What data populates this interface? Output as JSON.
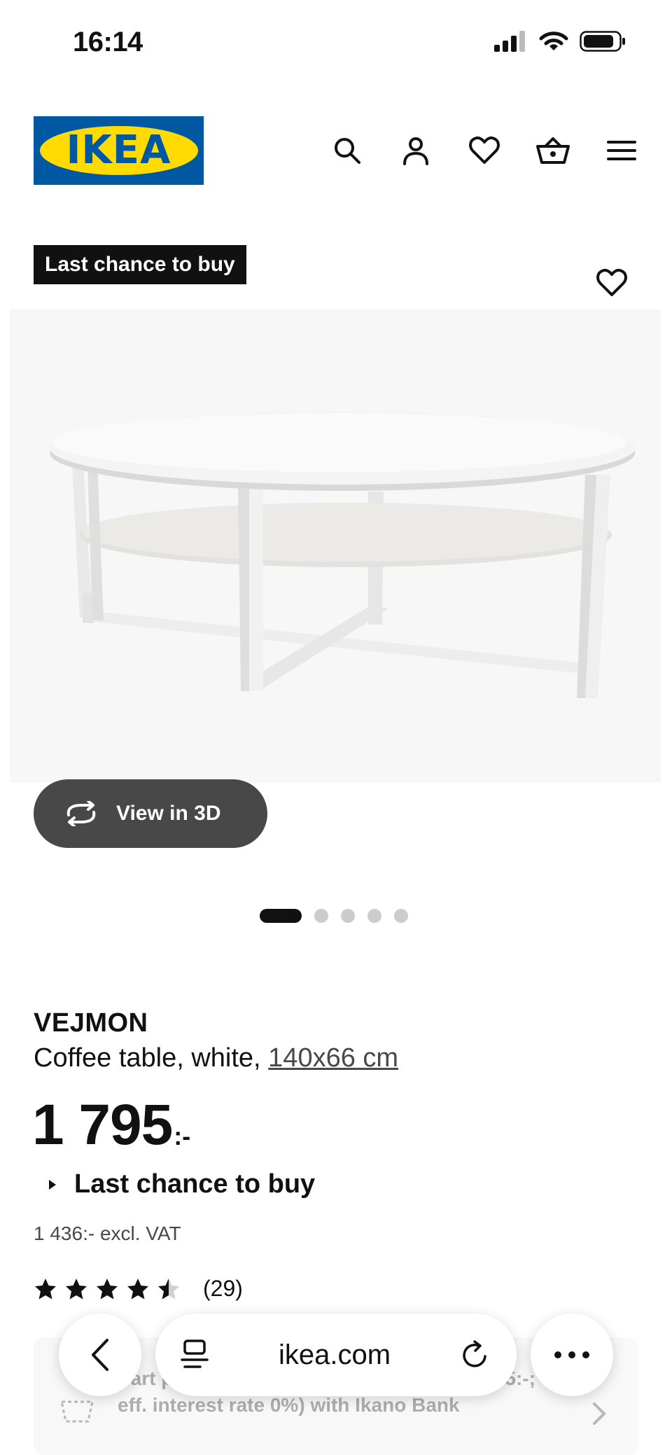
{
  "status_bar": {
    "time": "16:14"
  },
  "header": {
    "logo_text": "IKEA",
    "icons": [
      "search-icon",
      "account-icon",
      "heart-icon",
      "cart-icon",
      "menu-icon"
    ]
  },
  "badge": {
    "label": "Last chance to buy"
  },
  "media": {
    "view3d_label": "View in 3D",
    "slide_count": 5,
    "active_slide": 1
  },
  "product": {
    "name": "VEJMON",
    "desc": "Coffee table, white, ",
    "size": "140x66 cm",
    "price": "1 795",
    "price_suffix": ":-",
    "availability": "Last chance to buy",
    "excl_vat": "1 436:- excl. VAT",
    "rating_value": 4.5,
    "rating_count": "(29)"
  },
  "financing": {
    "text": "Part pay 160:-/month (10 months, Tot 1 795:-; eff. interest rate 0%) with Ikano Bank"
  },
  "browser": {
    "url": "ikea.com"
  },
  "colors": {
    "brand_blue": "#0058a3",
    "brand_yellow": "#ffdb00",
    "dark": "#111111",
    "button_grey": "#484848"
  }
}
